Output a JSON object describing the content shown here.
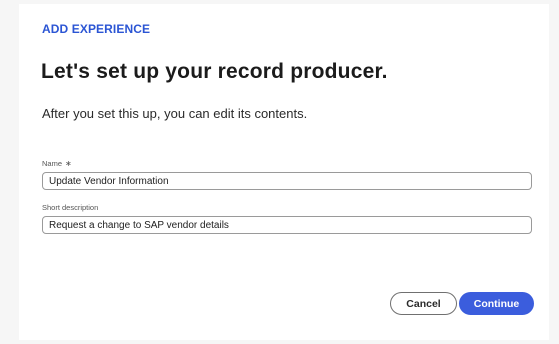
{
  "dialog": {
    "eyebrow": "ADD EXPERIENCE",
    "title": "Let's set up your record producer.",
    "subtitle": "After you set this up, you can edit its contents."
  },
  "form": {
    "name": {
      "label": "Name",
      "required_marker": "∗",
      "value": "Update Vendor Information"
    },
    "short_description": {
      "label": "Short description",
      "value": "Request a change to SAP vendor details"
    }
  },
  "actions": {
    "cancel_label": "Cancel",
    "continue_label": "Continue"
  },
  "colors": {
    "accent": "#3b5ddd",
    "eyebrow": "#2b55d4"
  }
}
